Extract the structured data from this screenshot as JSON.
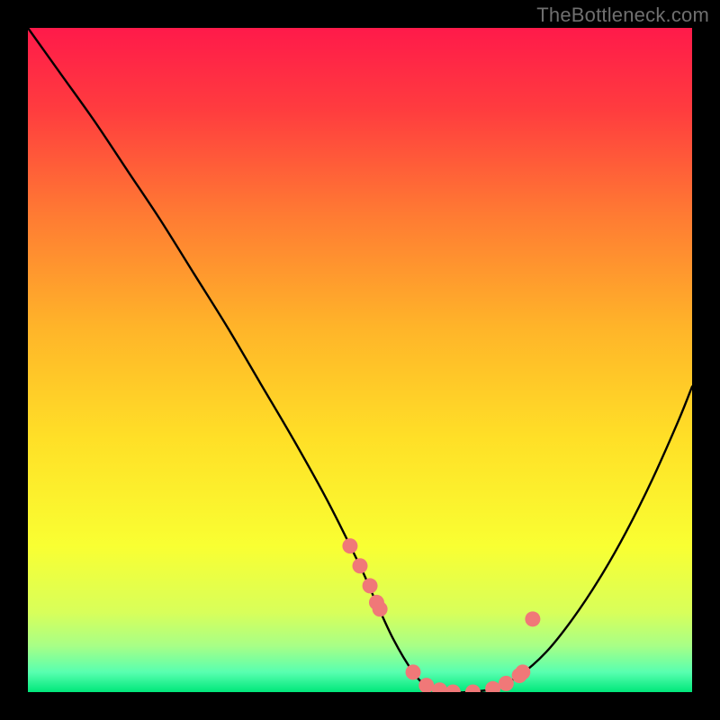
{
  "watermark": "TheBottleneck.com",
  "chart_data": {
    "type": "line",
    "title": "",
    "xlabel": "",
    "ylabel": "",
    "xlim": [
      0,
      100
    ],
    "ylim": [
      0,
      100
    ],
    "curve": {
      "x": [
        0,
        5,
        10,
        15,
        20,
        25,
        30,
        35,
        40,
        45,
        50,
        52,
        55,
        58,
        60,
        63,
        66,
        70,
        74,
        78,
        82,
        86,
        90,
        94,
        98,
        100
      ],
      "y": [
        100,
        93,
        86,
        78.5,
        71,
        63,
        55,
        46.5,
        38,
        29,
        19,
        14.5,
        8,
        3,
        1,
        0,
        0,
        0.5,
        2.5,
        6,
        11,
        17,
        24,
        32,
        41,
        46
      ]
    },
    "markers": {
      "x": [
        48.5,
        50.0,
        51.5,
        52.5,
        53.0,
        58.0,
        60.0,
        62.0,
        64.0,
        67.0,
        70.0,
        72.0,
        74.0,
        74.5,
        76.0
      ],
      "y": [
        22.0,
        19.0,
        16.0,
        13.5,
        12.5,
        3.0,
        1.0,
        0.3,
        0.0,
        0.0,
        0.5,
        1.3,
        2.5,
        3.0,
        11.0
      ]
    },
    "gradient_stops": [
      {
        "pct": 0,
        "color": "#ff1a4a"
      },
      {
        "pct": 12,
        "color": "#ff3b3f"
      },
      {
        "pct": 28,
        "color": "#ff7a33"
      },
      {
        "pct": 45,
        "color": "#ffb429"
      },
      {
        "pct": 62,
        "color": "#ffe027"
      },
      {
        "pct": 78,
        "color": "#f9ff32"
      },
      {
        "pct": 88,
        "color": "#d8ff5a"
      },
      {
        "pct": 93,
        "color": "#a8ff86"
      },
      {
        "pct": 97,
        "color": "#58ffb0"
      },
      {
        "pct": 100,
        "color": "#00e77a"
      }
    ],
    "marker_color": "#f07878",
    "curve_color": "#000000"
  }
}
